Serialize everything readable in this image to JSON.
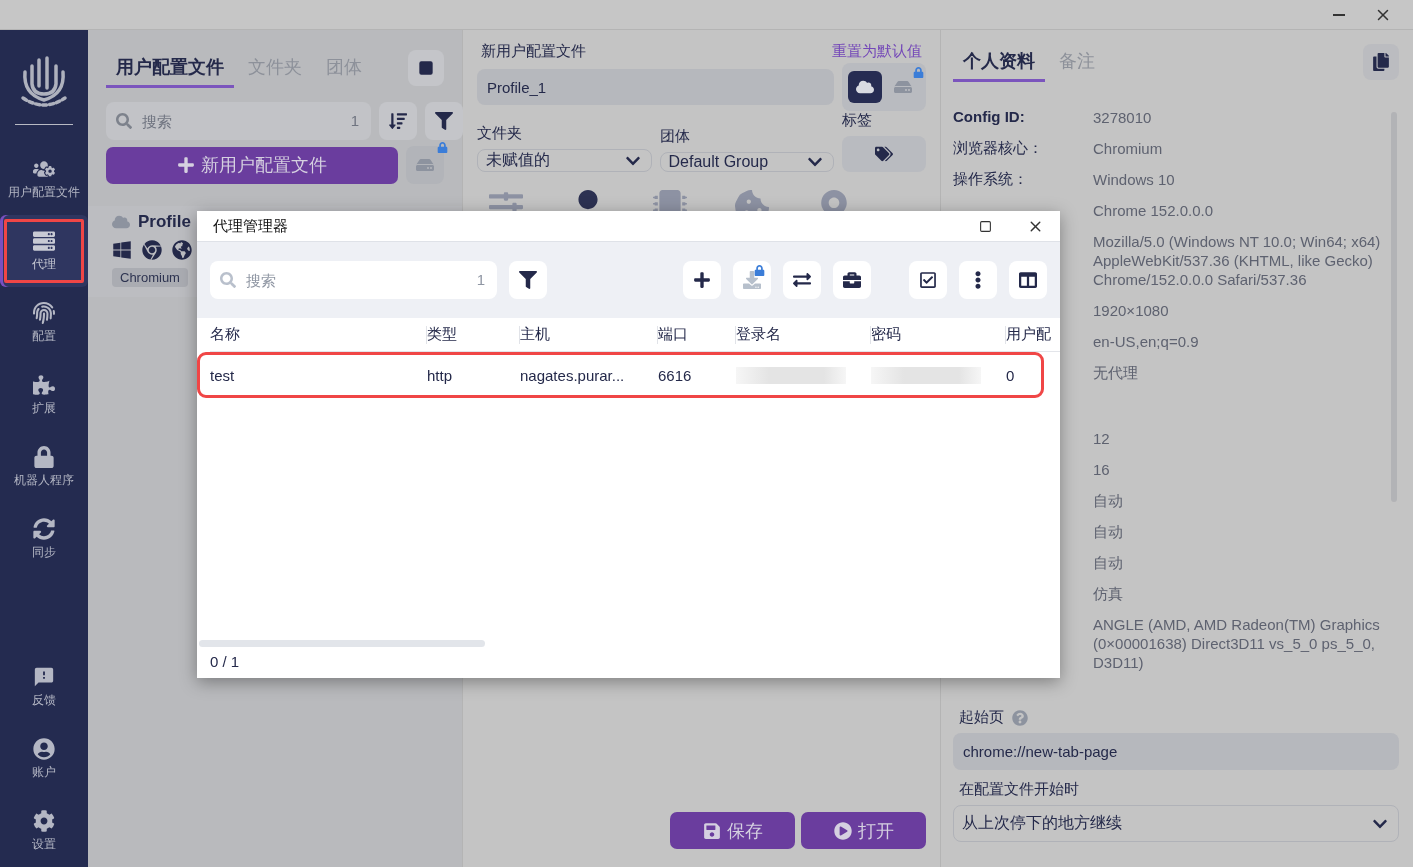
{
  "sidebar": {
    "items": [
      {
        "label": "用户配置文件",
        "selected": false,
        "highlighted": false
      },
      {
        "label": "代理",
        "selected": true,
        "highlighted": true
      },
      {
        "label": "配置",
        "selected": false,
        "highlighted": false
      },
      {
        "label": "扩展",
        "selected": false,
        "highlighted": false
      },
      {
        "label": "机器人程序",
        "selected": false,
        "highlighted": false
      },
      {
        "label": "同步",
        "selected": false,
        "highlighted": false
      }
    ],
    "bottom_items": [
      {
        "label": "反馈"
      },
      {
        "label": "账户"
      },
      {
        "label": "设置"
      }
    ]
  },
  "profiles_panel": {
    "tabs": [
      {
        "label": "用户配置文件",
        "selected": true
      },
      {
        "label": "文件夹",
        "selected": false
      },
      {
        "label": "团体",
        "selected": false
      }
    ],
    "search": {
      "placeholder": "搜索",
      "count": "1"
    },
    "new_button": "新用户配置文件",
    "profiles": [
      {
        "name": "Profile",
        "badge": "Chromium"
      }
    ]
  },
  "editor": {
    "title": "新用户配置文件",
    "reset_link": "重置为默认值",
    "name_value": "Profile_1",
    "storage": [
      {
        "selected": true,
        "locked": false
      },
      {
        "selected": false,
        "locked": true
      }
    ],
    "folder": {
      "label": "文件夹",
      "value": "未赋值的"
    },
    "group": {
      "label": "团体",
      "value": "Default Group"
    },
    "tags": {
      "label": "标签"
    },
    "buttons": [
      {
        "label": "保存"
      },
      {
        "label": "打开"
      }
    ]
  },
  "details": {
    "tabs": [
      {
        "label": "个人资料",
        "selected": true
      },
      {
        "label": "备注",
        "selected": false
      }
    ],
    "rows": [
      {
        "kind": "pair",
        "label": "Config ID:",
        "value": "3278010"
      },
      {
        "kind": "pair",
        "label": "浏览器核心：",
        "value": "Chromium"
      },
      {
        "kind": "pair",
        "label": "操作系统：",
        "value": "Windows 10"
      },
      {
        "kind": "pair",
        "value": "Chrome 152.0.0.0"
      },
      {
        "kind": "pair",
        "value": "Mozilla/5.0 (Windows NT 10.0; Win64; x64) AppleWebKit/537.36 (KHTML, like Gecko) Chrome/152.0.0.0 Safari/537.36"
      },
      {
        "kind": "pair",
        "value": "1920×1080"
      },
      {
        "kind": "pair",
        "value": "en-US,en;q=0.9"
      },
      {
        "kind": "pair",
        "value": "无代理"
      },
      {
        "kind": "blank"
      },
      {
        "kind": "pair",
        "value": "12"
      },
      {
        "kind": "pair",
        "value": "16"
      },
      {
        "kind": "pair",
        "value": "自动"
      },
      {
        "kind": "pair",
        "value": "自动"
      },
      {
        "kind": "pair",
        "value": "自动"
      },
      {
        "kind": "pair",
        "value": "仿真"
      },
      {
        "kind": "pair",
        "value": "ANGLE (AMD, AMD Radeon(TM) Graphics (0×00001638) Direct3D11 vs_5_0 ps_5_0, D3D11)"
      }
    ],
    "start_page": {
      "label": "起始页",
      "value": "chrome://new-tab-page"
    },
    "on_start": {
      "label": "在配置文件开始时",
      "value": "从上次停下的地方继续"
    }
  },
  "proxy_manager": {
    "title": "代理管理器",
    "search": {
      "placeholder": "搜索",
      "count": "1"
    },
    "tools": [
      {
        "disabled": false
      },
      {
        "disabled": true
      },
      {
        "disabled": false
      },
      {
        "disabled": false
      },
      {
        "disabled": false
      },
      {
        "disabled": false
      },
      {
        "disabled": false
      }
    ],
    "columns": [
      "名称",
      "类型",
      "主机",
      "端口",
      "登录名",
      "密码",
      "用户配"
    ],
    "rows": [
      {
        "highlighted": true,
        "cells": [
          {
            "kind": "text",
            "text": "test"
          },
          {
            "kind": "text",
            "text": "http"
          },
          {
            "kind": "text",
            "text": "nagates.purar..."
          },
          {
            "kind": "text",
            "text": "6616"
          },
          {
            "kind": "redacted"
          },
          {
            "kind": "redacted"
          },
          {
            "kind": "text",
            "text": "0"
          }
        ]
      }
    ],
    "footer": "0 / 1"
  }
}
